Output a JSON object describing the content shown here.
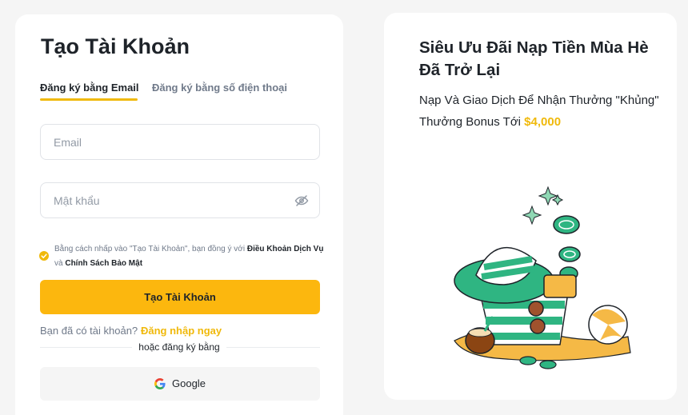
{
  "signup": {
    "title": "Tạo Tài Khoản",
    "tabs": {
      "email": "Đăng ký bằng Email",
      "phone": "Đăng ký bằng số điện thoại"
    },
    "email_placeholder": "Email",
    "password_placeholder": "Mật khẩu",
    "agreement": {
      "prefix": "Bằng cách nhấp vào \"Tạo Tài Khoản\", bạn đồng ý với ",
      "terms": "Điều Khoản Dịch Vụ",
      "and": " và ",
      "privacy": "Chính Sách Bảo Mật"
    },
    "create_button": "Tạo Tài Khoản",
    "have_account": "Bạn đã có tài khoản?",
    "login_link": "Đăng nhập ngay",
    "or_signup_with": "hoặc đăng ký bằng",
    "google_button": "Google"
  },
  "promo": {
    "title": "Siêu Ưu Đãi Nạp Tiền Mùa Hè Đã Trở Lại",
    "subtitle": "Nạp Và Giao Dịch Để Nhận Thưởng \"Khủng\" Thưởng Bonus Tới",
    "amount": "$4,000",
    "illustration_icon": "summer-beach-bag-illustration"
  },
  "colors": {
    "accent": "#f0b90b",
    "button": "#fcb70e",
    "text": "#1e2329",
    "muted": "#707a8a",
    "background": "#f5f5f5"
  }
}
